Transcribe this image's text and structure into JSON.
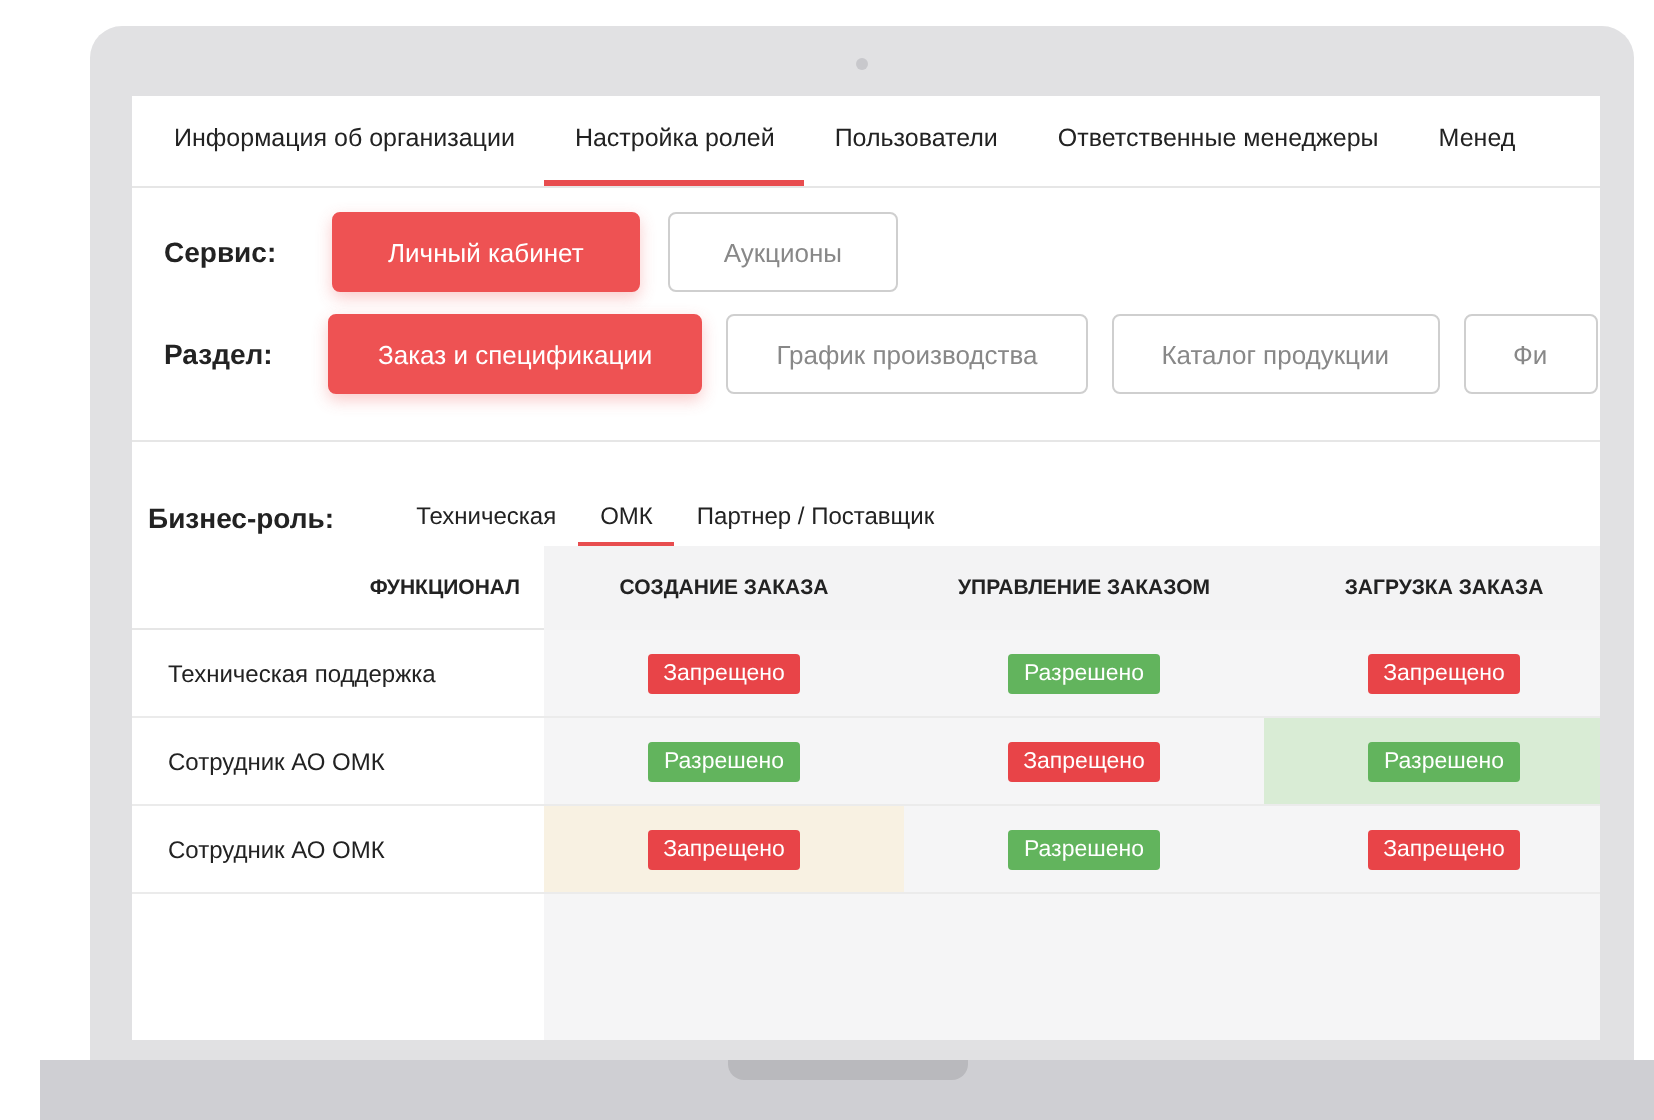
{
  "tabs": [
    {
      "label": "Информация об организации",
      "selected": false
    },
    {
      "label": "Настройка ролей",
      "selected": true
    },
    {
      "label": "Пользователи",
      "selected": false
    },
    {
      "label": "Ответственные менеджеры",
      "selected": false
    },
    {
      "label": "Менед",
      "selected": false
    }
  ],
  "service": {
    "label": "Сервис:",
    "options": [
      {
        "label": "Личный кабинет",
        "selected": true
      },
      {
        "label": "Аукционы",
        "selected": false
      }
    ]
  },
  "section": {
    "label": "Раздел:",
    "options": [
      {
        "label": "Заказ и спецификации",
        "selected": true
      },
      {
        "label": "График производства",
        "selected": false
      },
      {
        "label": "Каталог продукции",
        "selected": false
      },
      {
        "label": "Фи",
        "selected": false
      }
    ]
  },
  "business_role": {
    "label": "Бизнес-роль:",
    "tabs": [
      {
        "label": "Техническая",
        "selected": false
      },
      {
        "label": "ОМК",
        "selected": true
      },
      {
        "label": "Партнер / Поставщик",
        "selected": false
      }
    ]
  },
  "table": {
    "columns": [
      "ФУНКЦИОНАЛ",
      "СОЗДАНИЕ ЗАКАЗА",
      "УПРАВЛЕНИЕ ЗАКАЗОМ",
      "ЗАГРУЗКА ЗАКАЗА"
    ],
    "rows": [
      {
        "cells": [
          {
            "kind": "text",
            "text": "Техническая поддержка"
          },
          {
            "kind": "badge",
            "allowed": false,
            "text": "Запрещено"
          },
          {
            "kind": "badge",
            "allowed": true,
            "text": "Разрешено"
          },
          {
            "kind": "badge",
            "allowed": false,
            "text": "Запрещено"
          }
        ]
      },
      {
        "cells": [
          {
            "kind": "text",
            "text": "Сотрудник АО ОМК"
          },
          {
            "kind": "badge",
            "allowed": true,
            "text": "Разрешено"
          },
          {
            "kind": "badge",
            "allowed": false,
            "text": "Запрещено"
          },
          {
            "kind": "badge",
            "allowed": true,
            "text": "Разрешено",
            "color": "#d9ecd5"
          }
        ]
      },
      {
        "cells": [
          {
            "kind": "text",
            "text": "Сотрудник АО ОМК"
          },
          {
            "kind": "badge",
            "allowed": false,
            "text": "Запрещено",
            "color": "#f8f1e2"
          },
          {
            "kind": "badge",
            "allowed": true,
            "text": "Разрешено"
          },
          {
            "kind": "badge",
            "allowed": false,
            "text": "Запрещено"
          }
        ]
      }
    ]
  }
}
